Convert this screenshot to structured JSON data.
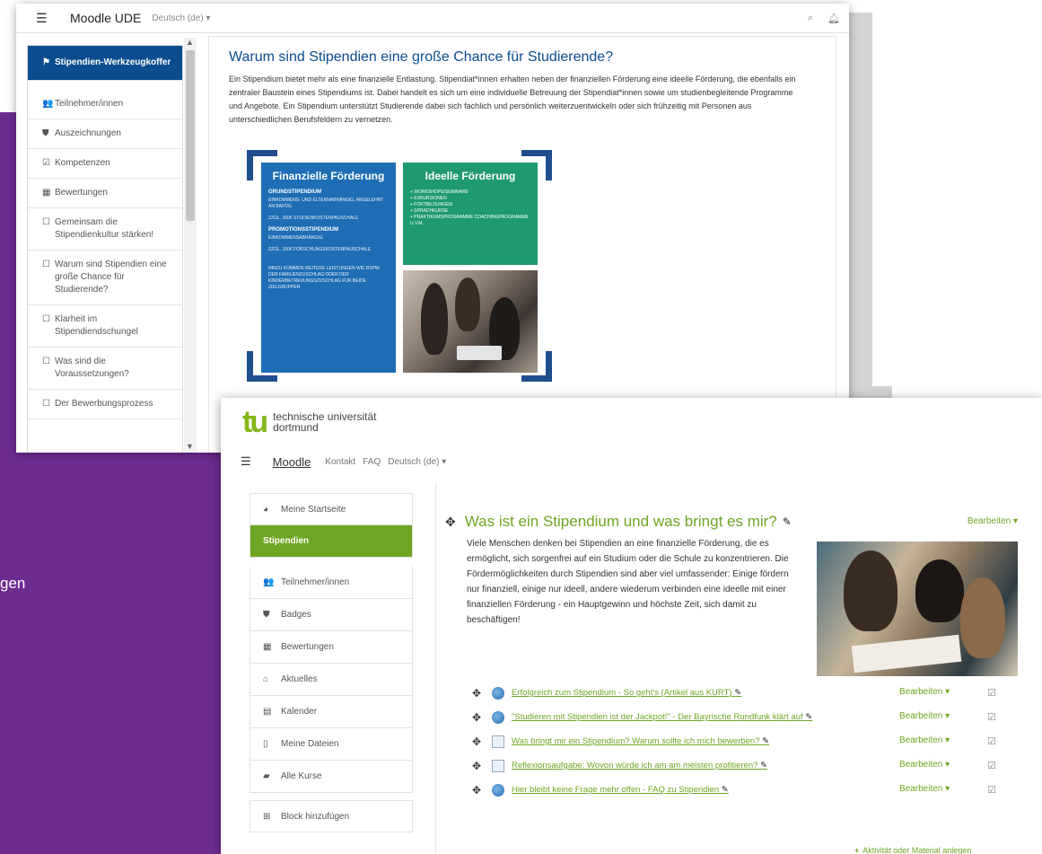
{
  "bg": {
    "partial_text": "gen"
  },
  "ude": {
    "brand": "Moodle UDE",
    "lang": "Deutsch (de) ▾",
    "sidebar": [
      {
        "icon": "flag-icon",
        "glyph": "⚑",
        "label": "Stipendien-Werkzeugkoffer",
        "active": true
      },
      {
        "icon": "users-icon",
        "glyph": "👥",
        "label": "Teilnehmer/innen"
      },
      {
        "icon": "shield-icon",
        "glyph": "⛊",
        "label": "Auszeichnungen"
      },
      {
        "icon": "checkbox-icon",
        "glyph": "☑",
        "label": "Kompetenzen"
      },
      {
        "icon": "table-icon",
        "glyph": "▦",
        "label": "Bewertungen"
      },
      {
        "icon": "folder-icon",
        "glyph": "☐",
        "label": "Gemeinsam die Stipendienkultur stärken!"
      },
      {
        "icon": "folder-icon",
        "glyph": "☐",
        "label": "Warum sind Stipendien eine große Chance für Studierende?"
      },
      {
        "icon": "folder-icon",
        "glyph": "☐",
        "label": "Klarheit im Stipendiendschungel"
      },
      {
        "icon": "folder-icon",
        "glyph": "☐",
        "label": "Was sind die Voraussetzungen?"
      },
      {
        "icon": "folder-icon",
        "glyph": "☐",
        "label": "Der Bewerbungsprozess"
      }
    ],
    "title": "Warum sind Stipendien eine große Chance für Studierende?",
    "paragraph": "Ein Stipendium bietet mehr als eine finanzielle Entlastung. Stipendiat*innen erhalten neben der finanziellen Förderung eine ideelle Förderung, die ebenfalls ein zentraler Baustein eines Stipendiums ist. Dabei handelt es sich um eine individuelle Betreuung der Stipendiat*innen sowie um studienbegleitende Programme und Angebote. Ein Stipendium unterstützt Studierende dabei sich fachlich und persönlich weiterzuentwickeln oder sich frühzeitig mit Personen aus unterschiedlichen Berufsfeldern zu vernetzen.",
    "infographic": {
      "fin_title": "Finanzielle Förderung",
      "grund": "GRUNDSTIPENDIUM",
      "grund_1": "EINKOMMENS- UND ELTERNABHÄNGIG, ANGELEHNT AN BAFÖG",
      "grund_2": "ZZGL. 300€ STUDIENKOSTENPAUSCHALE",
      "promo": "PROMOTIONSSTIPENDIUM",
      "promo_1": "EINKOMMENSABHÄNGIG",
      "promo_2": "ZZGL. 100€ FORSCHUNGSKOSTENPAUSCHALE",
      "hinzu": "HINZU KOMMEN WEITERE LEISTUNGEN WIE BSPW. DER FAMILIENZUSCHLAG ODER DER KINDERBETREUUNGSZUSCHLAG FÜR BEIDE ZIELGRUPPEN",
      "ide_title": "Ideelle Förderung",
      "ide_items": [
        "+ WORKSHOPS/SEMINARE",
        "+ EXKURSIONEN",
        "+ FORTBILDUNGEN",
        "+ SPRACHKURSE",
        "+ PRAKTIKUMSPROGRAMME COACHINGPROGRAMME U.V.M."
      ]
    }
  },
  "tud": {
    "logo_mark": "tu",
    "logo_line1": "technische universität",
    "logo_line2": "dortmund",
    "nav": {
      "brand": "Moodle",
      "kontakt": "Kontakt",
      "faq": "FAQ",
      "lang": "Deutsch (de) ▾"
    },
    "sidebar": [
      {
        "icon": "dashboard-icon",
        "glyph": "◕",
        "label": "Meine Startseite"
      },
      {
        "icon": "",
        "glyph": "",
        "label": "Stipendien",
        "active": true
      },
      {
        "icon": "users-icon",
        "glyph": "👥",
        "label": "Teilnehmer/innen"
      },
      {
        "icon": "shield-icon",
        "glyph": "⛊",
        "label": "Badges"
      },
      {
        "icon": "table-icon",
        "glyph": "▦",
        "label": "Bewertungen"
      },
      {
        "icon": "home-icon",
        "glyph": "⌂",
        "label": "Aktuelles"
      },
      {
        "icon": "calendar-icon",
        "glyph": "▤",
        "label": "Kalender"
      },
      {
        "icon": "file-icon",
        "glyph": "▯",
        "label": "Meine Dateien"
      },
      {
        "icon": "courses-icon",
        "glyph": "▰",
        "label": "Alle Kurse"
      }
    ],
    "add_block": "Block hinzufügen",
    "section_title": "Was ist ein Stipendium und was bringt es mir?",
    "edit_label": "Bearbeiten ▾",
    "paragraph": "Viele Menschen denken bei Stipendien an eine finanzielle Förderung, die es ermöglicht, sich sorgenfrei auf ein Studium oder die Schule zu konzentrieren. Die Fördermöglichkeiten durch Stipendien sind aber viel umfassender: Einige fördern nur finanziell, einige nur ideell, andere wiederum verbinden eine ideelle mit einer finanziellen Förderung - ein Hauptgewinn und höchste Zeit, sich damit zu beschäftigen!",
    "activities": [
      {
        "type": "url",
        "name": "Erfolgreich zum Stipendium - So geht's (Artikel aus KURT)",
        "edit": "Bearbeiten ▾"
      },
      {
        "type": "url",
        "name": "\"Studieren mit Stipendien ist der Jackpot!\" - Der Bayrische Rundfunk klärt auf",
        "edit": "Bearbeiten ▾"
      },
      {
        "type": "page",
        "name": "Was bringt mir ein Stipendium? Warum sollte ich mich bewerben?",
        "edit": "Bearbeiten ▾"
      },
      {
        "type": "page",
        "name": "Reflexionsaufgabe: Wovon würde ich am am meisten profitieren?",
        "edit": "Bearbeiten ▾"
      },
      {
        "type": "url",
        "name": "Hier bleibt keine Frage mehr offen - FAQ zu Stipendien",
        "edit": "Bearbeiten ▾"
      }
    ],
    "add_activity": "Aktivität oder Material anlegen"
  }
}
